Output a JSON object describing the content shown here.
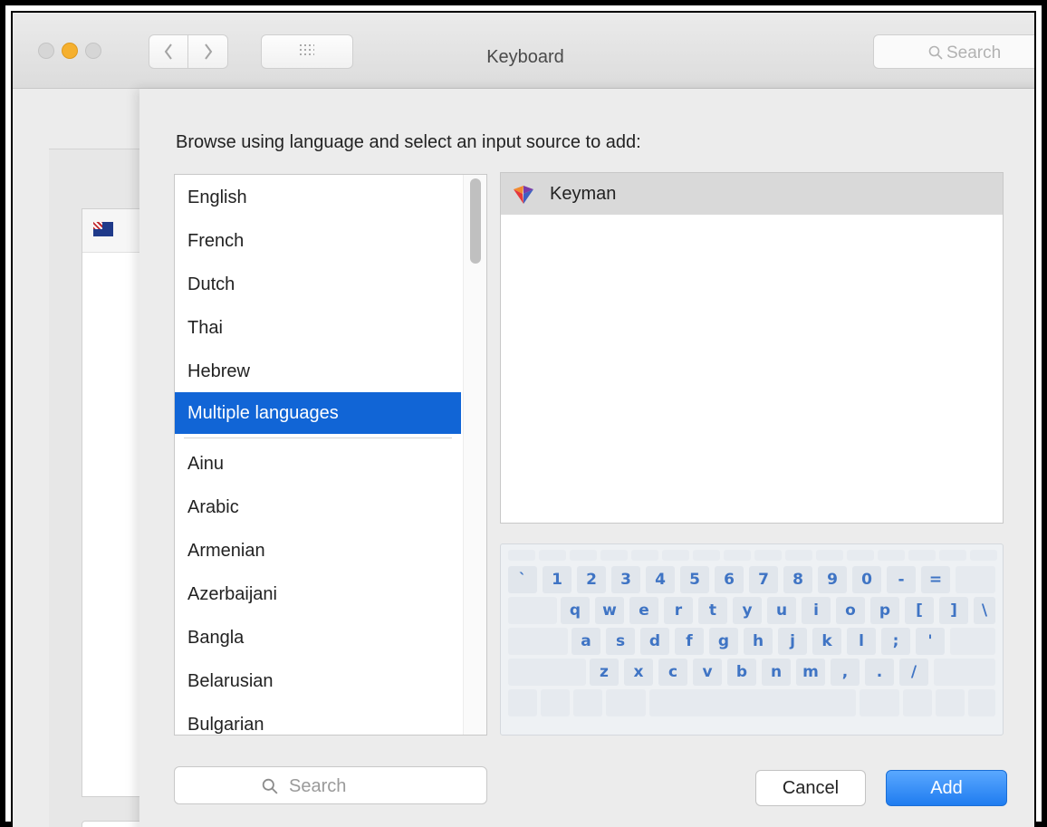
{
  "window": {
    "title": "Keyboard",
    "search_placeholder": "Search"
  },
  "sheet": {
    "prompt": "Browse using language and select an input source to add:",
    "languages_top": [
      "English",
      "French",
      "Dutch",
      "Thai",
      "Hebrew",
      "Multiple languages"
    ],
    "selected_language": "Multiple languages",
    "languages_all": [
      "Ainu",
      "Arabic",
      "Armenian",
      "Azerbaijani",
      "Bangla",
      "Belarusian",
      "Bulgarian"
    ],
    "input_sources": [
      {
        "label": "Keyman",
        "icon": "keyman-icon",
        "selected": true
      }
    ],
    "keyboard_rows": [
      [
        "`",
        "1",
        "2",
        "3",
        "4",
        "5",
        "6",
        "7",
        "8",
        "9",
        "0",
        "-",
        "="
      ],
      [
        "q",
        "w",
        "e",
        "r",
        "t",
        "y",
        "u",
        "i",
        "o",
        "p",
        "[",
        "]",
        "\\"
      ],
      [
        "a",
        "s",
        "d",
        "f",
        "g",
        "h",
        "j",
        "k",
        "l",
        ";",
        "'"
      ],
      [
        "z",
        "x",
        "c",
        "v",
        "b",
        "n",
        "m",
        ",",
        ".",
        "/"
      ]
    ],
    "search_placeholder": "Search",
    "cancel_label": "Cancel",
    "add_label": "Add"
  },
  "colors": {
    "selection": "#1165d6",
    "key_text": "#3f74c4",
    "add_button": "#1f7cf0"
  }
}
